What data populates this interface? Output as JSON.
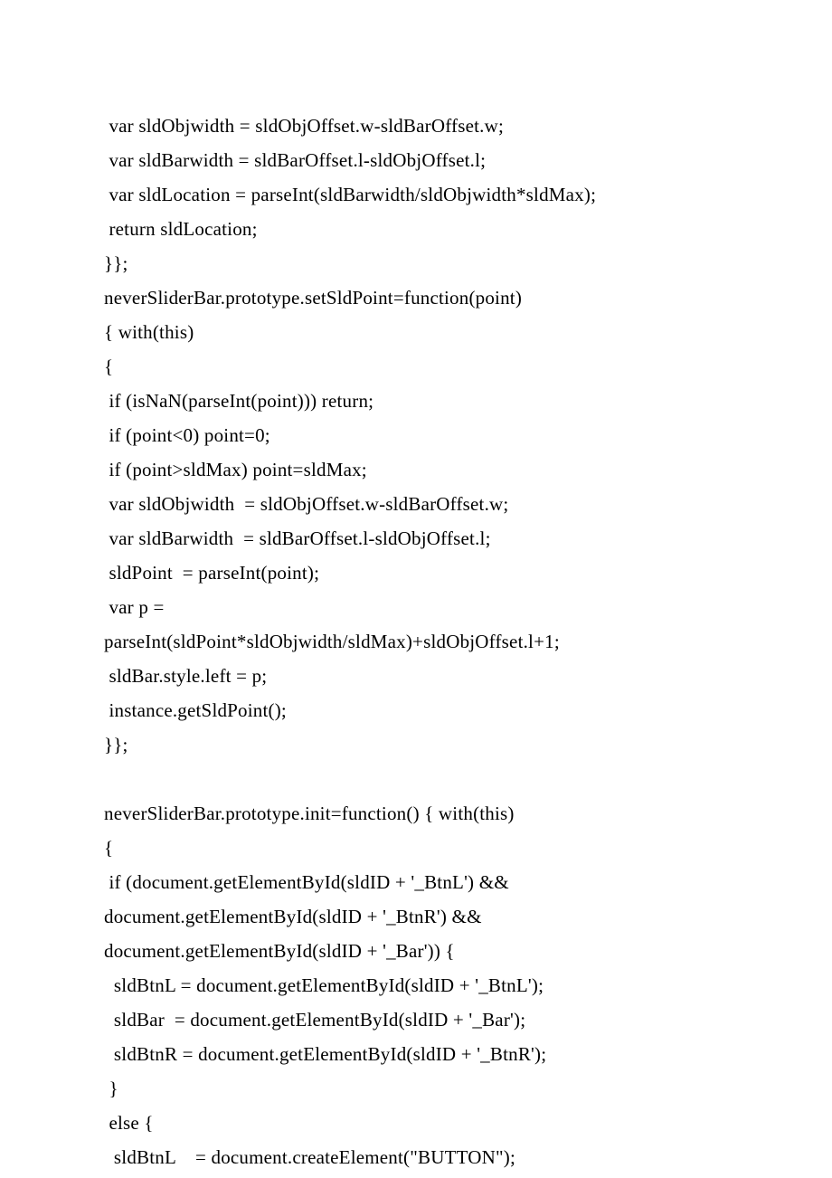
{
  "code_lines": [
    " var sldObjwidth = sldObjOffset.w-sldBarOffset.w;",
    " var sldBarwidth = sldBarOffset.l-sldObjOffset.l;",
    " var sldLocation = parseInt(sldBarwidth/sldObjwidth*sldMax);",
    " return sldLocation;",
    "}};",
    "neverSliderBar.prototype.setSldPoint=function(point)",
    "{ with(this)",
    "{",
    " if (isNaN(parseInt(point))) return;",
    " if (point<0) point=0;",
    " if (point>sldMax) point=sldMax;",
    " var sldObjwidth  = sldObjOffset.w-sldBarOffset.w;",
    " var sldBarwidth  = sldBarOffset.l-sldObjOffset.l;",
    " sldPoint  = parseInt(point);",
    " var p =",
    "parseInt(sldPoint*sldObjwidth/sldMax)+sldObjOffset.l+1;",
    " sldBar.style.left = p;",
    " instance.getSldPoint();",
    "}};",
    "",
    "neverSliderBar.prototype.init=function() { with(this)",
    "{",
    " if (document.getElementById(sldID + '_BtnL') &&",
    "document.getElementById(sldID + '_BtnR') &&",
    "document.getElementById(sldID + '_Bar')) {",
    "  sldBtnL = document.getElementById(sldID + '_BtnL');",
    "  sldBar  = document.getElementById(sldID + '_Bar');",
    "  sldBtnR = document.getElementById(sldID + '_BtnR');",
    " }",
    " else {",
    "  sldBtnL    = document.createElement(\"BUTTON\");"
  ]
}
